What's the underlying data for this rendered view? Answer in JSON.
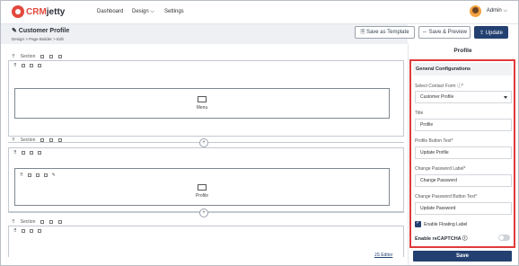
{
  "brand": {
    "crm": "CRM",
    "jetty": "jetty"
  },
  "nav": {
    "dashboard": "Dashboard",
    "design": "Design ⌵",
    "settings": "Settings"
  },
  "user": {
    "name": "Admin ⌵"
  },
  "header": {
    "title": "✎ Customer Profile",
    "breadcrumb": "Design  >  Page Builder  >  Edit"
  },
  "toolbar": {
    "save_template": "🗎 Save as Template",
    "save_preview": "⇔ Save & Preview",
    "update": "⇪ Update"
  },
  "canvas": {
    "section_label": "Section",
    "widgets": [
      "Menu",
      "Profile"
    ],
    "js_editor": "JS Editor"
  },
  "panel": {
    "title": "Profile",
    "config_heading": "General Configurations",
    "contact_form_label": "Select Contact Form ⓘ*",
    "contact_form_value": "Customer Profile",
    "title_label": "Title",
    "title_value": "Profile",
    "button_text_label": "Profile Button Text*",
    "button_text_value": "Update Profile",
    "change_pw_label": "Change Password Label*",
    "change_pw_value": "Change Password",
    "change_pw_btn_label": "Change Password Button Text*",
    "change_pw_btn_value": "Update Password",
    "floating_label": "Enable Floating Label",
    "floating_enabled": true,
    "recaptcha_label": "Enable reCAPTCHA ⓘ",
    "recaptcha_enabled": false,
    "save": "Save"
  },
  "colors": {
    "accent": "#234071",
    "brand": "#e2483d",
    "highlight": "#e03a3a"
  }
}
